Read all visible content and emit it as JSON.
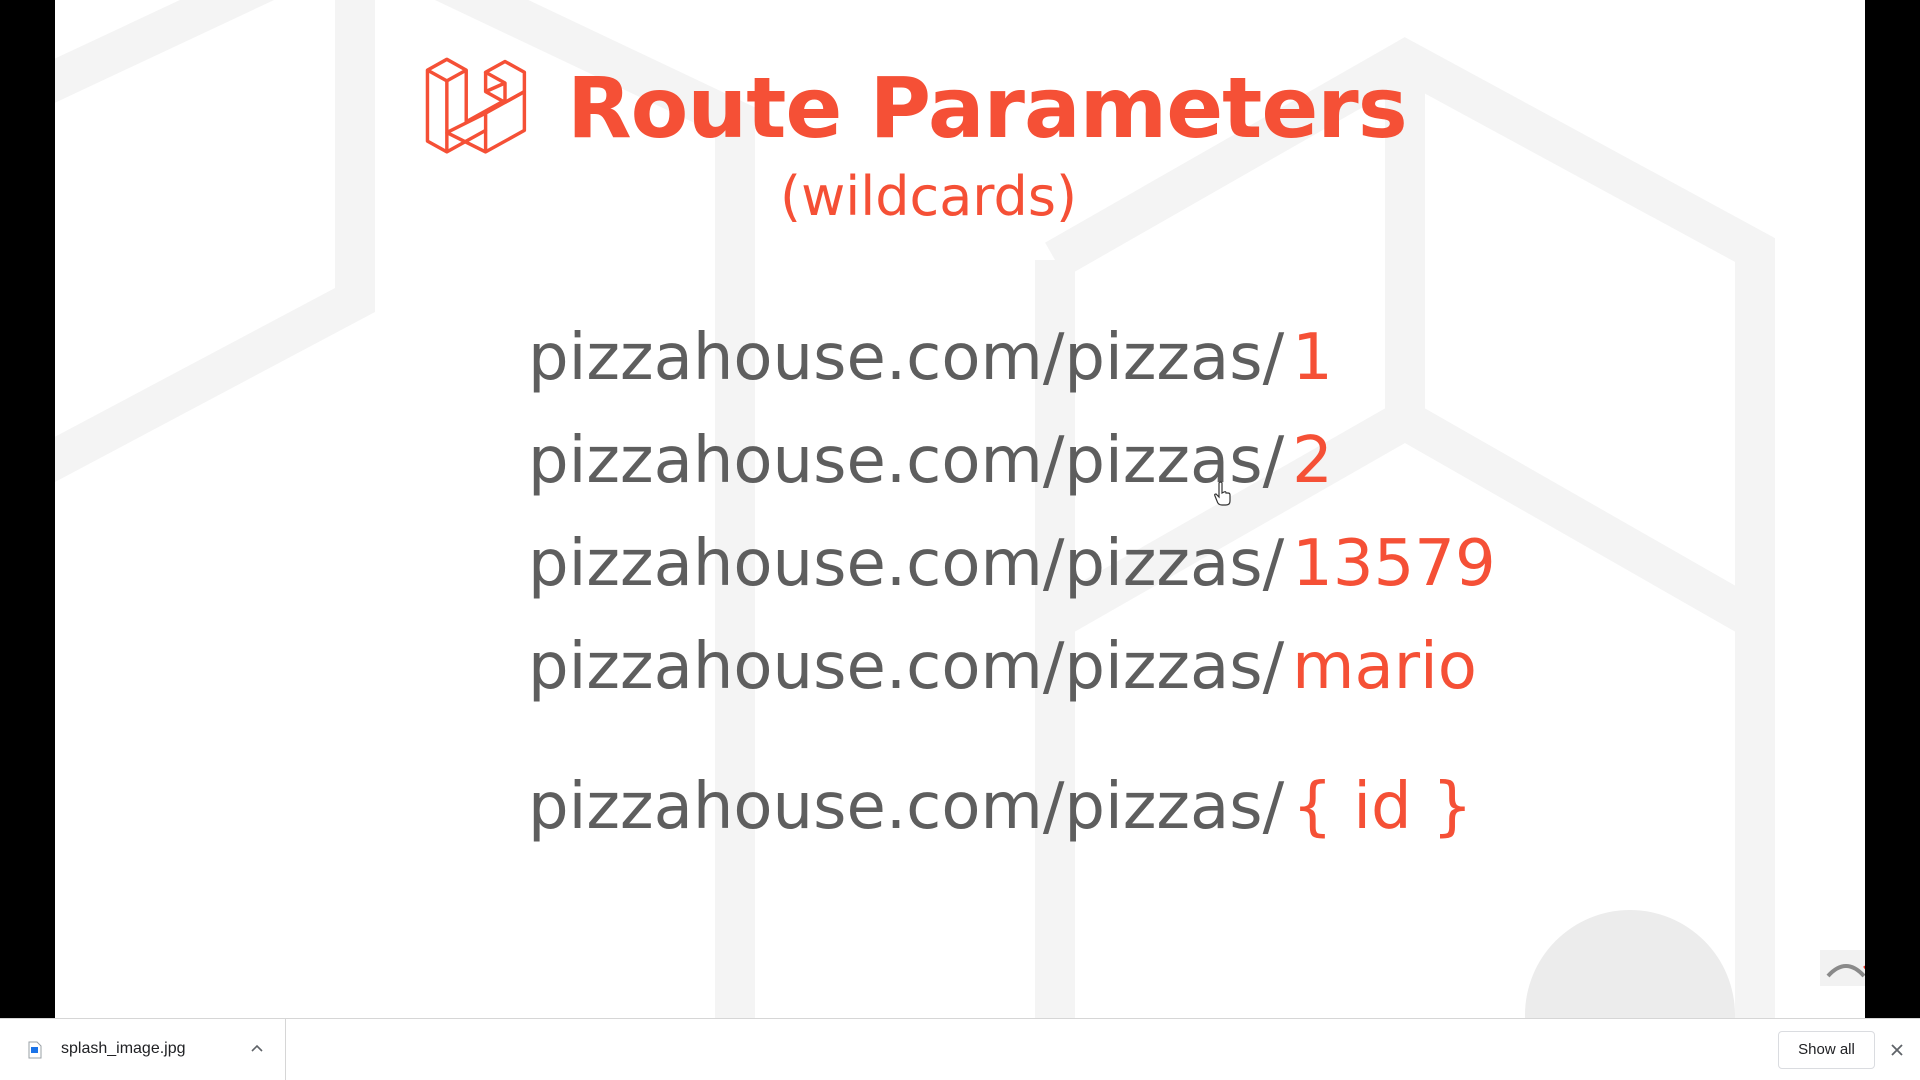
{
  "slide": {
    "title": "Route Parameters",
    "subtitle": "(wildcards)",
    "urls": [
      {
        "base": "pizzahouse.com/pizzas/",
        "param": "1"
      },
      {
        "base": "pizzahouse.com/pizzas/",
        "param": "2"
      },
      {
        "base": "pizzahouse.com/pizzas/",
        "param": "13579"
      },
      {
        "base": "pizzahouse.com/pizzas/",
        "param": "mario"
      },
      {
        "base": "pizzahouse.com/pizzas/",
        "param": "{ id }"
      }
    ],
    "accent_color": "#f55036",
    "text_color": "#5e5e5e",
    "logo_icon": "laravel-logo-icon"
  },
  "download_bar": {
    "file_name": "splash_image.jpg",
    "show_all_label": "Show all",
    "file_icon": "image-file-icon",
    "menu_icon": "chevron-up-icon",
    "close_icon": "close-icon"
  }
}
